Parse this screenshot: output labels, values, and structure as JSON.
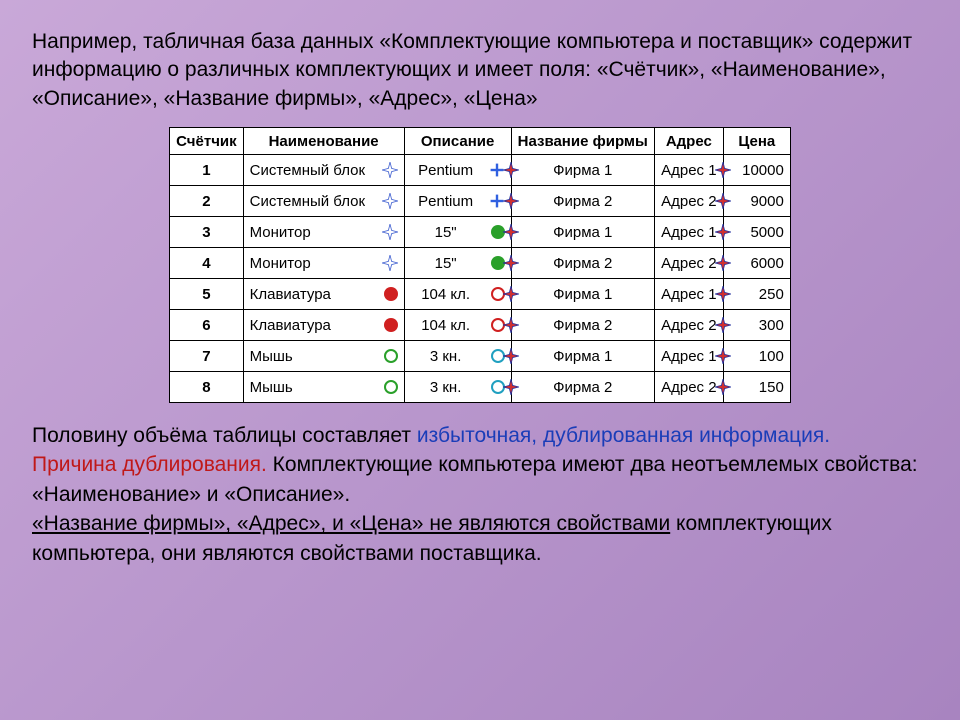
{
  "intro": "Например, табличная база данных «Комплектующие компьютера и поставщик» содержит информацию о различных комплектующих и имеет поля: «Счётчик», «Наименование», «Описание», «Название фирмы», «Адрес», «Цена»",
  "headers": {
    "counter": "Счётчик",
    "name": "Наименование",
    "desc": "Описание",
    "firm": "Название фирмы",
    "addr": "Адрес",
    "price": "Цена"
  },
  "rows": [
    {
      "n": "1",
      "name": "Системный блок",
      "desc": "Pentium",
      "firm": "Фирма 1",
      "addr": "Адрес 1",
      "price": "10000",
      "ic": "blueplus"
    },
    {
      "n": "2",
      "name": "Системный блок",
      "desc": "Pentium",
      "firm": "Фирма 2",
      "addr": "Адрес 2",
      "price": "9000",
      "ic": "blueplus"
    },
    {
      "n": "3",
      "name": "Монитор",
      "desc": "15\"",
      "firm": "Фирма 1",
      "addr": "Адрес 1",
      "price": "5000",
      "ic": "greendot"
    },
    {
      "n": "4",
      "name": "Монитор",
      "desc": "15\"",
      "firm": "Фирма 2",
      "addr": "Адрес 2",
      "price": "6000",
      "ic": "greendot"
    },
    {
      "n": "5",
      "name": "Клавиатура",
      "desc": "104 кл.",
      "firm": "Фирма 1",
      "addr": "Адрес 1",
      "price": "250",
      "ic": "redcirc"
    },
    {
      "n": "6",
      "name": "Клавиатура",
      "desc": "104 кл.",
      "firm": "Фирма 2",
      "addr": "Адрес 2",
      "price": "300",
      "ic": "redcirc"
    },
    {
      "n": "7",
      "name": "Мышь",
      "desc": "3 кн.",
      "firm": "Фирма 1",
      "addr": "Адрес 1",
      "price": "100",
      "ic": "cyancirc"
    },
    {
      "n": "8",
      "name": "Мышь",
      "desc": "3 кн.",
      "firm": "Фирма 2",
      "addr": "Адрес 2",
      "price": "150",
      "ic": "cyancirc"
    }
  ],
  "explain": {
    "p1a": "Половину объёма таблицы составляет ",
    "p1b": "избыточная, дублированная информация.",
    "p2a": "Причина дублирования.",
    "p2b": " Комплектующие компьютера имеют два неотъемлемых свойства: «Наименование» и «Описание».",
    "p3a": "«Название фирмы», «Адрес», и «Цена» не являются свойствами",
    "p3b": " комплектующих компьютера, они являются свойствами поставщика."
  }
}
